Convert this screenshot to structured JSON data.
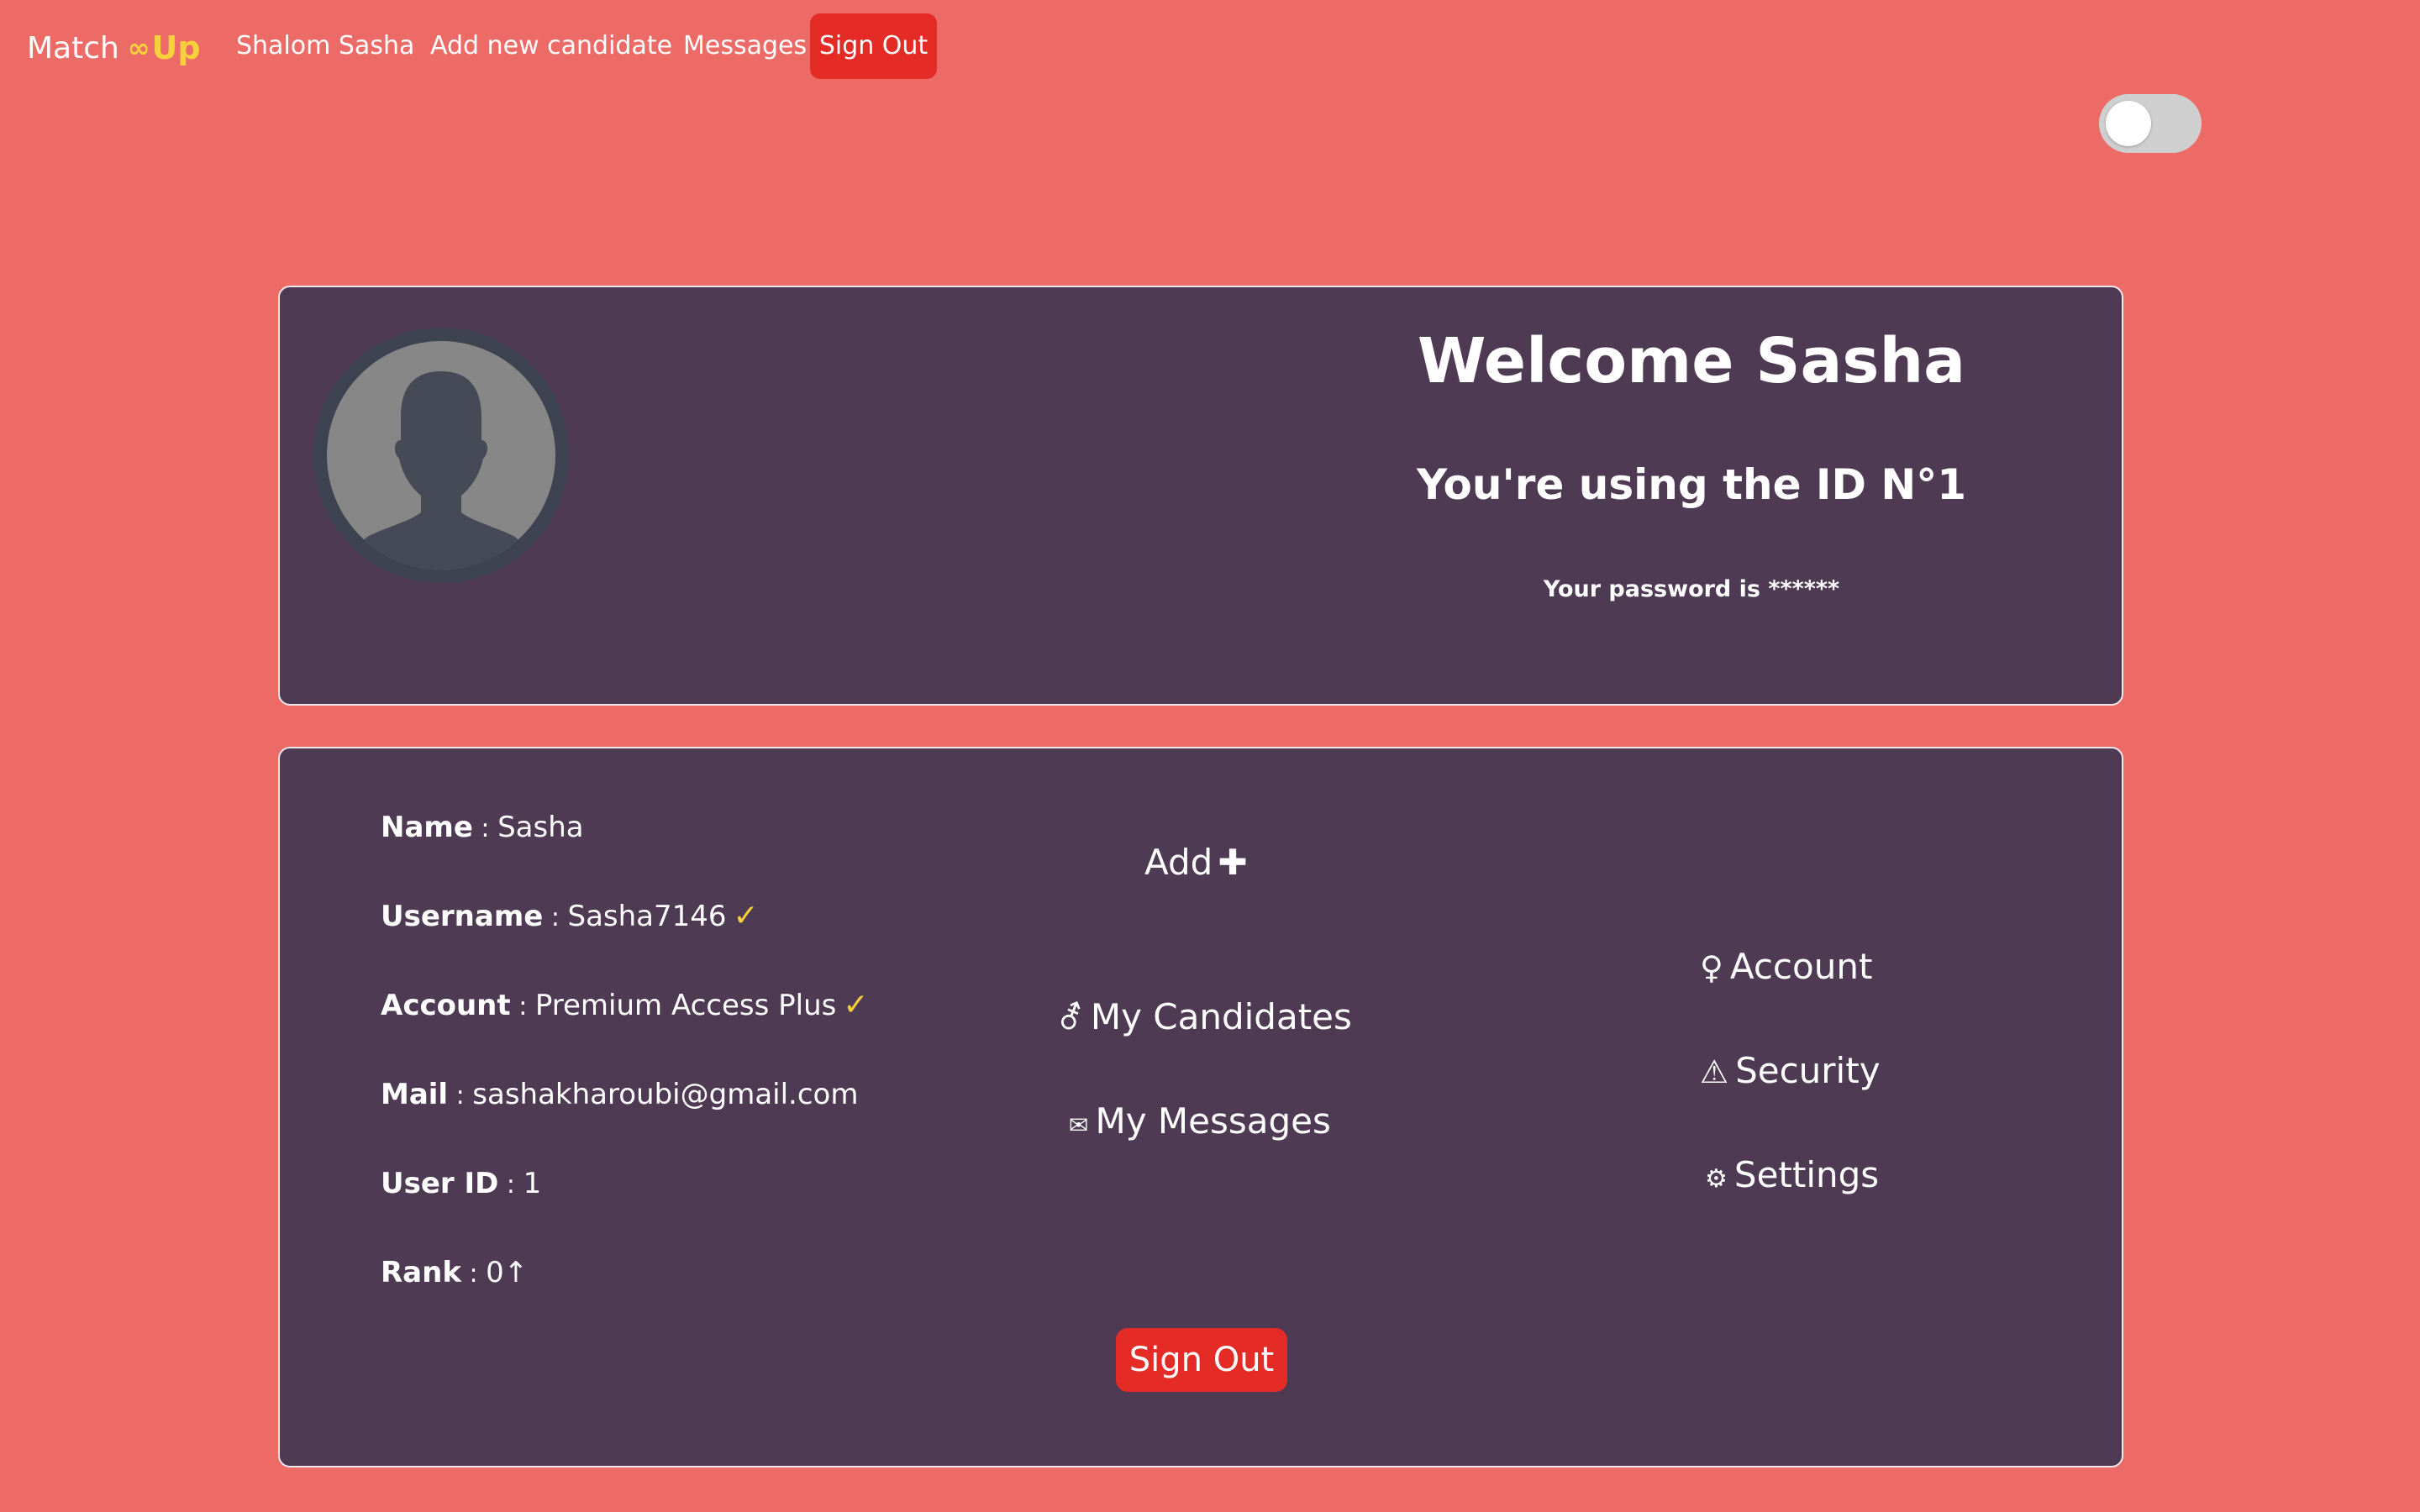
{
  "navbar": {
    "brand_text": "Match",
    "brand_icon": "∞",
    "brand_accent": "Up",
    "links": [
      "Shalom Sasha",
      "Add new candidate",
      "Messages"
    ],
    "signout_label": "Sign Out"
  },
  "toggle": {
    "state": "off"
  },
  "profile": {
    "welcome": "Welcome Sasha",
    "id_text": "You're using the ID N°1",
    "password_text": "Your password is ******"
  },
  "details": {
    "name": {
      "label": "Name",
      "value": "Sasha"
    },
    "username": {
      "label": "Username",
      "value": "Sasha7146",
      "check": "✓"
    },
    "account": {
      "label": "Account",
      "value": "Premium Access Plus",
      "check": "✓"
    },
    "mail": {
      "label": "Mail",
      "value": "sashakharoubi@gmail.com"
    },
    "user_id": {
      "label": "User ID",
      "value": "1"
    },
    "rank": {
      "label": "Rank",
      "value": "0",
      "arrow": "↑"
    }
  },
  "actions": {
    "add": "Add",
    "add_icon": "✚",
    "candidates_icon": "⚦",
    "candidates": "My Candidates",
    "messages_icon": "✉",
    "messages": "My Messages"
  },
  "menu": {
    "account_icon": "♀",
    "account": "Account",
    "security_icon": "⚠",
    "security": "Security",
    "settings_icon": "⚙",
    "settings": "Settings"
  },
  "signout_button": "Sign Out",
  "colors": {
    "background": "#ed6b67",
    "card": "#4f3a53",
    "accent_yellow": "#f7d13c",
    "button_red": "#e42b25"
  }
}
